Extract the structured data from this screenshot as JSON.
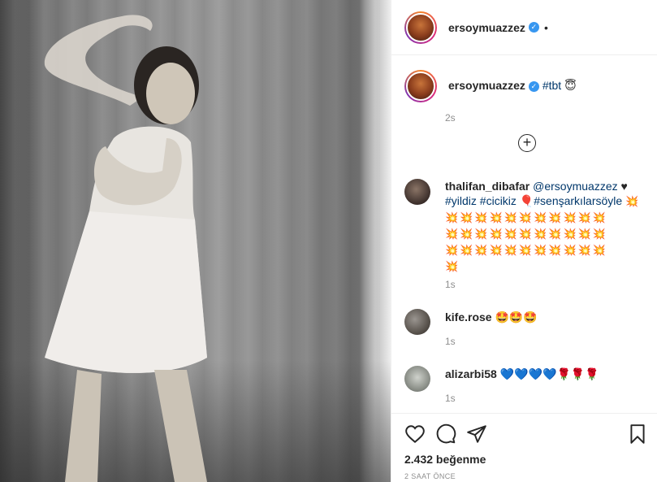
{
  "post": {
    "author": "ersoymuazzez",
    "verified": true,
    "header_dot": "•",
    "caption_tag": "#tbt",
    "caption_emoji": "😇",
    "caption_time": "2s",
    "load_more": "+"
  },
  "comments": [
    {
      "user": "thalifan_dibafar",
      "mention": "@ersoymuazzez",
      "heart": "♥",
      "tags": [
        "#yildiz",
        "#cicikiz",
        "#senşarkılarsöyle"
      ],
      "balloon": "🎈",
      "bursts_line1": "💥",
      "bursts_line2": "💥💥💥💥💥💥💥💥💥💥💥",
      "bursts_line3": "💥💥💥💥💥💥💥💥💥💥💥",
      "bursts_line4": "💥💥💥💥💥💥💥💥💥💥💥",
      "bursts_line5": "💥",
      "time": "1s"
    },
    {
      "user": "kife.rose",
      "text": "🤩🤩🤩",
      "time": "1s"
    },
    {
      "user": "alizarbi58",
      "text": "💙💙💙💙🌹🌹🌹",
      "time": "1s"
    }
  ],
  "footer": {
    "likes": "2.432 beğenme",
    "posted_ago": "2 SAAT ÖNCE"
  },
  "icons": {
    "like": "heart-outline-icon",
    "comment": "comment-bubble-icon",
    "share": "paper-plane-icon",
    "save": "bookmark-icon",
    "verified": "verified-badge-icon",
    "load_more": "plus-circle-icon"
  },
  "colors": {
    "link": "#00376b",
    "verified": "#3897f0",
    "muted": "#8e8e8e",
    "text": "#262626"
  }
}
